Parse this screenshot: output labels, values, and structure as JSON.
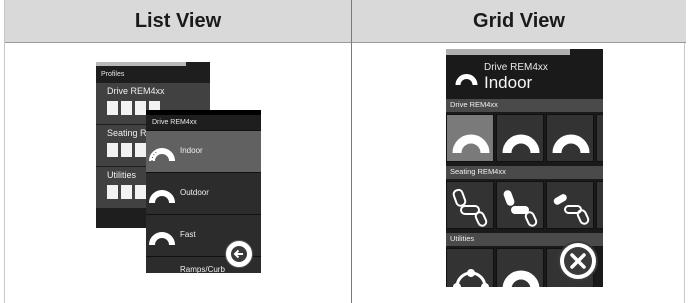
{
  "columns": [
    {
      "header": "List View"
    },
    {
      "header": "Grid View"
    }
  ],
  "list_view": {
    "back_panel": {
      "title": "Profiles",
      "rows": [
        {
          "label": "Drive REM4xx"
        },
        {
          "label": "Seating REM4xx"
        },
        {
          "label": "Utilities"
        }
      ]
    },
    "front_panel": {
      "title": "Drive REM4xx",
      "items": [
        {
          "label": "Indoor",
          "selected": true
        },
        {
          "label": "Outdoor",
          "selected": false
        },
        {
          "label": "Fast",
          "selected": false
        },
        {
          "label": "Ramps/Curb",
          "selected": false
        }
      ]
    },
    "back_button_icon": "arrow-left-icon"
  },
  "grid_view": {
    "device": "Drive REM4xx",
    "profile": "Indoor",
    "sections": [
      {
        "label": "Drive REM4xx"
      },
      {
        "label": "Seating REM4xx"
      },
      {
        "label": "Utilities"
      }
    ],
    "close_icon": "x-icon"
  },
  "colors": {
    "header_bg": "#d9d9d9",
    "screen_bg": "#1a1a1a",
    "selected_tile": "#7a7a7a"
  }
}
